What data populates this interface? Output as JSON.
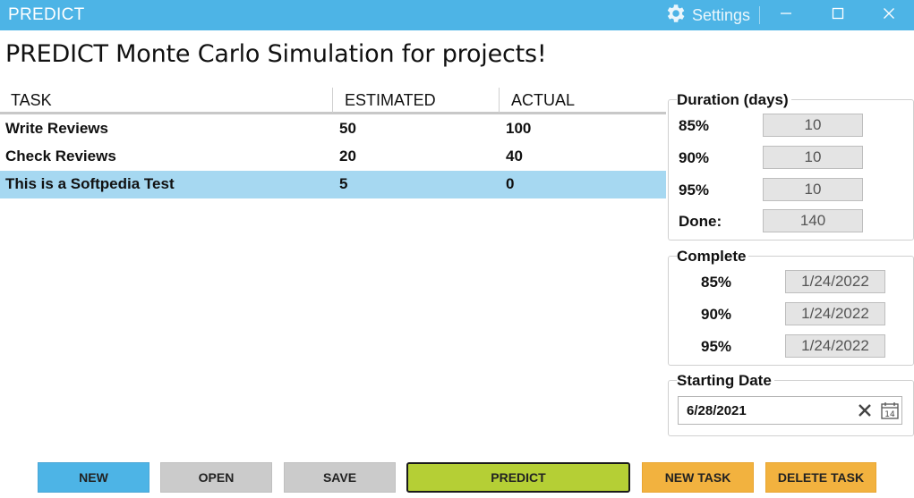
{
  "window": {
    "app_name": "PREDICT",
    "settings_label": "Settings"
  },
  "page_title": "PREDICT Monte Carlo Simulation for projects!",
  "grid": {
    "columns": [
      "TASK",
      "ESTIMATED",
      "ACTUAL"
    ],
    "rows": [
      {
        "task": "Write Reviews",
        "estimated": "50",
        "actual": "100"
      },
      {
        "task": "Check Reviews",
        "estimated": "20",
        "actual": "40"
      },
      {
        "task": "This is a Softpedia Test",
        "estimated": "5",
        "actual": "0"
      }
    ],
    "selected_row": 2
  },
  "duration": {
    "label": "Duration (days)",
    "items": [
      {
        "label": "85%",
        "value": "10"
      },
      {
        "label": "90%",
        "value": "10"
      },
      {
        "label": "95%",
        "value": "10"
      },
      {
        "label": "Done:",
        "value": "140"
      }
    ]
  },
  "complete": {
    "label": "Complete",
    "items": [
      {
        "label": "85%",
        "value": "1/24/2022"
      },
      {
        "label": "90%",
        "value": "1/24/2022"
      },
      {
        "label": "95%",
        "value": "1/24/2022"
      }
    ]
  },
  "starting_date": {
    "label": "Starting Date",
    "value": "6/28/2021",
    "calendar_day": "14"
  },
  "buttons": {
    "new": "NEW",
    "open": "OPEN",
    "save": "SAVE",
    "predict": "PREDICT",
    "new_task": "NEW TASK",
    "delete_task": "DELETE TASK"
  },
  "colors": {
    "title_bar": "#4db4e6",
    "selected_row": "#a6d8f1",
    "new_button": "#4db4e6",
    "predict_button": "#b5cf35",
    "task_buttons": "#f2b23f",
    "neutral_button": "#cbcbcb"
  },
  "icons": {
    "settings": "gear-icon",
    "minimize": "minimize-icon",
    "maximize": "maximize-icon",
    "close": "close-icon",
    "clear": "clear-x-icon",
    "calendar": "calendar-icon"
  }
}
